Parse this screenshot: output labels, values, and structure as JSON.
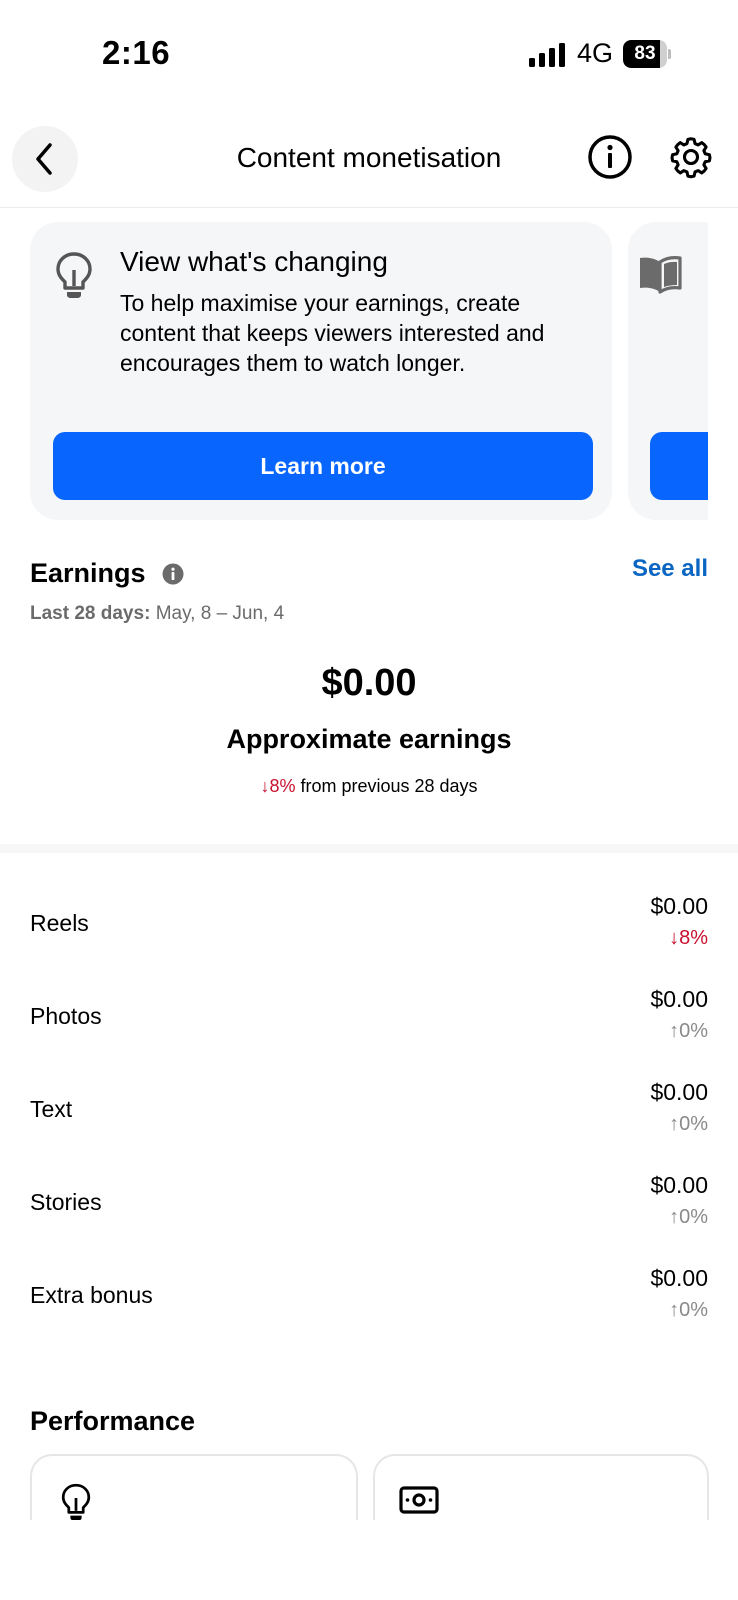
{
  "status_bar": {
    "time": "2:16",
    "network": "4G",
    "battery_level": "83",
    "battery_fraction": 0.83
  },
  "header": {
    "title": "Content monetisation",
    "icons": [
      "back-chevron-icon",
      "info-icon",
      "gear-icon"
    ]
  },
  "carousel": {
    "cards": [
      {
        "icon": "lightbulb-icon",
        "title": "View what's changing",
        "body": "To help maximise your earnings, create content that keeps viewers interested and encourages them to watch longer.",
        "button_label": "Learn more"
      },
      {
        "icon": "book-icon"
      }
    ]
  },
  "earnings": {
    "title": "Earnings",
    "see_all": "See all",
    "range_label": "Last 28 days:",
    "range_value": "May, 8 – Jun, 4",
    "total": "$0.00",
    "total_label": "Approximate earnings",
    "change_value": "↓8%",
    "change_text": "from previous 28 days"
  },
  "breakdown": [
    {
      "label": "Reels",
      "amount": "$0.00",
      "change": "↓8%",
      "trend": "down"
    },
    {
      "label": "Photos",
      "amount": "$0.00",
      "change": "↑0%",
      "trend": "flat"
    },
    {
      "label": "Text",
      "amount": "$0.00",
      "change": "↑0%",
      "trend": "flat"
    },
    {
      "label": "Stories",
      "amount": "$0.00",
      "change": "↑0%",
      "trend": "flat"
    },
    {
      "label": "Extra bonus",
      "amount": "$0.00",
      "change": "↑0%",
      "trend": "flat"
    }
  ],
  "performance": {
    "title": "Performance",
    "cards": [
      {
        "icon": "lightbulb-icon"
      },
      {
        "icon": "money-icon"
      }
    ]
  },
  "colors": {
    "accent_blue": "#0866ff",
    "link_blue": "#0a66c2",
    "down_red": "#c8102e",
    "card_bg": "#f5f6f8"
  }
}
